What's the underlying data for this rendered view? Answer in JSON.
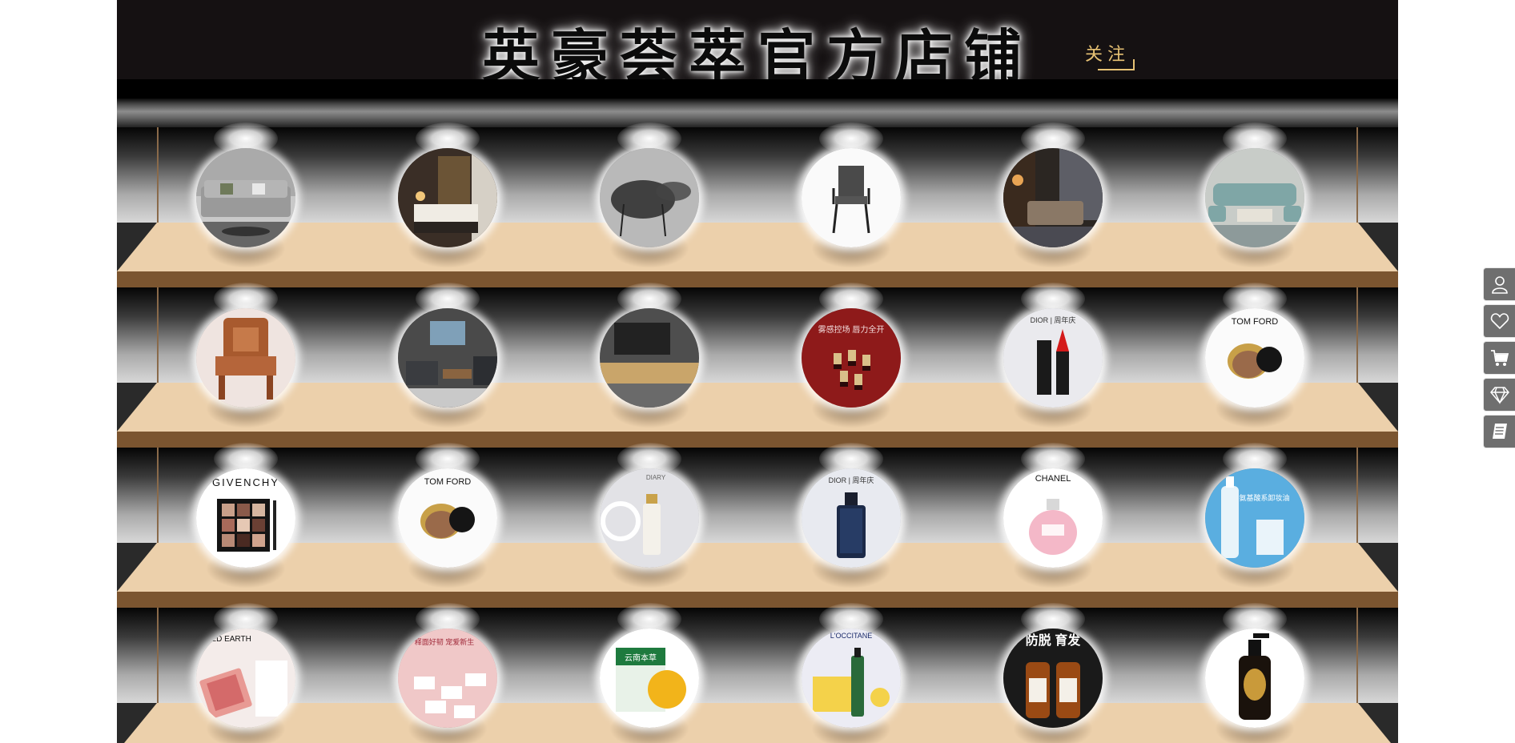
{
  "store": {
    "title": "英豪荟萃官方店铺",
    "follow_label": "关注"
  },
  "shelves": [
    {
      "products": [
        {
          "icon": "gray-sofa-photo"
        },
        {
          "icon": "bedroom-photo"
        },
        {
          "icon": "round-table-photo"
        },
        {
          "icon": "chair-photo"
        },
        {
          "icon": "lounge-sofa-photo"
        },
        {
          "icon": "living-room-set-photo"
        }
      ]
    },
    {
      "products": [
        {
          "icon": "carved-armchair-photo"
        },
        {
          "icon": "modern-living-room-photo"
        },
        {
          "icon": "tv-cabinet-photo"
        },
        {
          "icon": "lipstick-set-photo",
          "text": "雾感控场 唇力全开"
        },
        {
          "icon": "dior-lipstick-photo",
          "text": "DIOR | 周年庆"
        },
        {
          "icon": "tom-ford-cushion-photo",
          "text": "TOM FORD"
        }
      ]
    },
    {
      "products": [
        {
          "icon": "givenchy-palette-photo",
          "text": "GIVENCHY"
        },
        {
          "icon": "tom-ford-cushion-photo",
          "text": "TOM FORD"
        },
        {
          "icon": "serum-bottle-photo",
          "text": "DIARY"
        },
        {
          "icon": "dior-sauvage-photo",
          "text": "DIOR | 周年庆"
        },
        {
          "icon": "chanel-perfume-photo",
          "text": "CHANEL"
        },
        {
          "icon": "cleansing-oil-photo",
          "text": "氨基酸系卸妆油"
        }
      ]
    },
    {
      "products": [
        {
          "icon": "blush-compact-photo",
          "text": "RED EARTH"
        },
        {
          "icon": "soap-gift-photo",
          "text": "释面好韧 宠爱新生"
        },
        {
          "icon": "yunnan-herbal-soap-photo",
          "text": "云南本草"
        },
        {
          "icon": "loccitane-hair-photo",
          "text": "L'OCCITANE"
        },
        {
          "icon": "anti-hairloss-shampoo-photo",
          "text": "防脱 育发"
        },
        {
          "icon": "hair-serum-bottle-photo"
        }
      ]
    }
  ],
  "sidebar": {
    "buttons": [
      {
        "name": "user",
        "icon": "user-icon"
      },
      {
        "name": "favorites",
        "icon": "heart-icon"
      },
      {
        "name": "cart",
        "icon": "cart-icon"
      },
      {
        "name": "vip",
        "icon": "diamond-icon"
      },
      {
        "name": "orders",
        "icon": "book-icon"
      }
    ]
  }
}
